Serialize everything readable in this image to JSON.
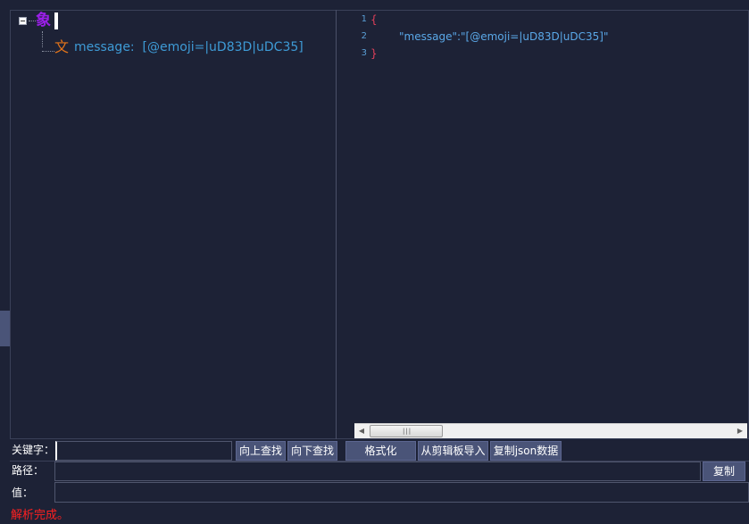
{
  "tree": {
    "root_glyph": "象",
    "child_glyph": "文",
    "child_text": "message:  [@emoji=|uD83D|uDC35]"
  },
  "code": {
    "lines": [
      {
        "num": "1",
        "text": "{"
      },
      {
        "num": "2",
        "text": "\"message\":\"[@emoji=|uD83D|uDC35]\""
      },
      {
        "num": "3",
        "text": "}"
      }
    ]
  },
  "scrollbar": {
    "left_arrow": "◀",
    "right_arrow": "▶",
    "grip": "|||"
  },
  "search": {
    "label": "关键字：",
    "value": "",
    "find_up_label": "向上查找",
    "find_down_label": "向下查找",
    "format_label": "格式化",
    "import_clipboard_label": "从剪辑板导入",
    "copy_json_label": "复制json数据"
  },
  "path": {
    "label": "路径：",
    "value": "",
    "copy_label": "复制"
  },
  "value": {
    "label": "值：",
    "value": ""
  },
  "status": {
    "text": "解析完成。",
    "color": "#ff2020"
  }
}
